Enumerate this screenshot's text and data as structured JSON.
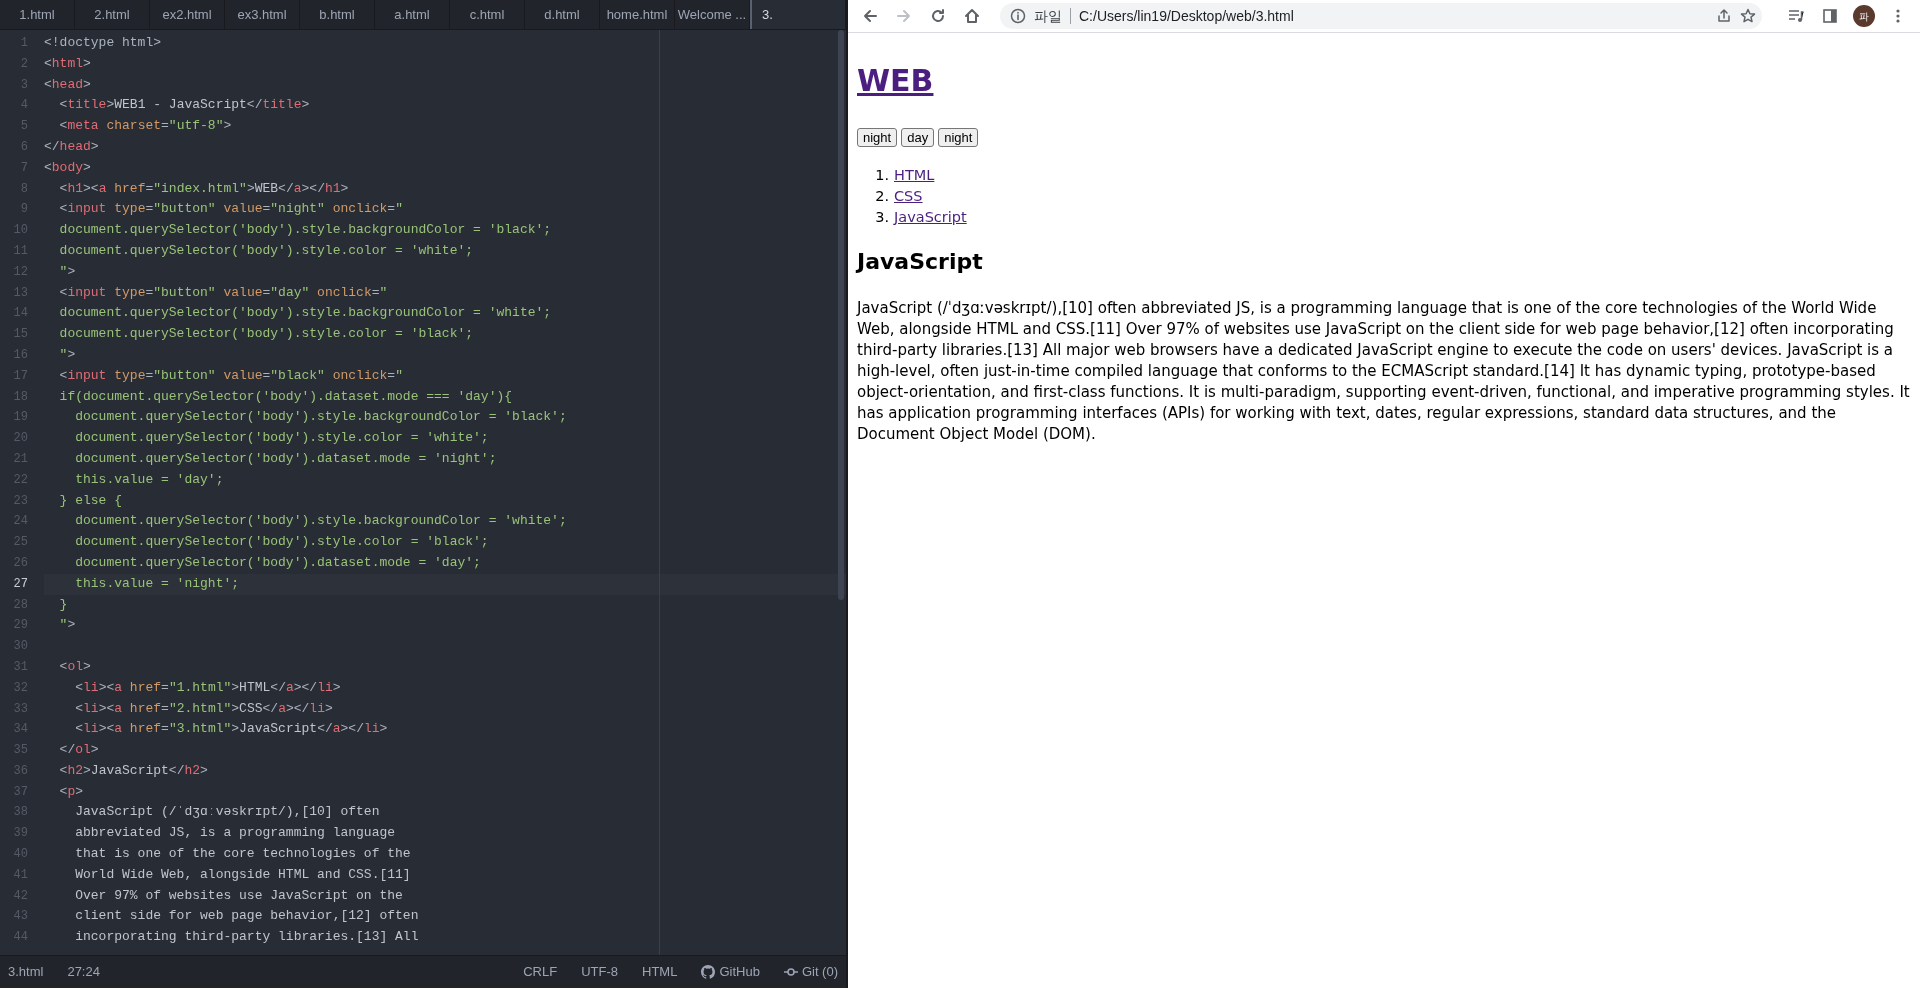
{
  "editor": {
    "tabs": [
      {
        "label": "1.html",
        "selected": false
      },
      {
        "label": "2.html",
        "selected": false
      },
      {
        "label": "ex2.html",
        "selected": false
      },
      {
        "label": "ex3.html",
        "selected": false
      },
      {
        "label": "b.html",
        "selected": false
      },
      {
        "label": "a.html",
        "selected": false
      },
      {
        "label": "c.html",
        "selected": false
      },
      {
        "label": "d.html",
        "selected": false
      },
      {
        "label": "home.html",
        "selected": false
      },
      {
        "label": "Welcome ...",
        "selected": false
      },
      {
        "label": "3.",
        "selected": true
      }
    ],
    "lines": [
      {
        "number": "1",
        "current": false,
        "tokens": [
          {
            "kind": "punct",
            "text": "<!doctype html>"
          }
        ]
      },
      {
        "number": "2",
        "current": false,
        "tokens": [
          {
            "kind": "punct",
            "text": "<"
          },
          {
            "kind": "tag",
            "text": "html"
          },
          {
            "kind": "punct",
            "text": ">"
          }
        ]
      },
      {
        "number": "3",
        "current": false,
        "tokens": [
          {
            "kind": "punct",
            "text": "<"
          },
          {
            "kind": "tag",
            "text": "head"
          },
          {
            "kind": "punct",
            "text": ">"
          }
        ]
      },
      {
        "number": "4",
        "current": false,
        "tokens": [
          {
            "kind": "punct",
            "text": "  <"
          },
          {
            "kind": "tag",
            "text": "title"
          },
          {
            "kind": "punct",
            "text": ">"
          },
          {
            "kind": "text",
            "text": "WEB1 - JavaScript"
          },
          {
            "kind": "punct",
            "text": "</"
          },
          {
            "kind": "tag",
            "text": "title"
          },
          {
            "kind": "punct",
            "text": ">"
          }
        ]
      },
      {
        "number": "5",
        "current": false,
        "tokens": [
          {
            "kind": "punct",
            "text": "  <"
          },
          {
            "kind": "tag",
            "text": "meta"
          },
          {
            "kind": "attr",
            "text": " charset"
          },
          {
            "kind": "punct",
            "text": "="
          },
          {
            "kind": "string",
            "text": "\"utf-8\""
          },
          {
            "kind": "punct",
            "text": ">"
          }
        ]
      },
      {
        "number": "6",
        "current": false,
        "tokens": [
          {
            "kind": "punct",
            "text": "</"
          },
          {
            "kind": "tag",
            "text": "head"
          },
          {
            "kind": "punct",
            "text": ">"
          }
        ]
      },
      {
        "number": "7",
        "current": false,
        "tokens": [
          {
            "kind": "punct",
            "text": "<"
          },
          {
            "kind": "tag",
            "text": "body"
          },
          {
            "kind": "punct",
            "text": ">"
          }
        ]
      },
      {
        "number": "8",
        "current": false,
        "tokens": [
          {
            "kind": "punct",
            "text": "  <"
          },
          {
            "kind": "tag",
            "text": "h1"
          },
          {
            "kind": "punct",
            "text": "><"
          },
          {
            "kind": "tag",
            "text": "a"
          },
          {
            "kind": "attr",
            "text": " href"
          },
          {
            "kind": "punct",
            "text": "="
          },
          {
            "kind": "string",
            "text": "\"index.html\""
          },
          {
            "kind": "punct",
            "text": ">"
          },
          {
            "kind": "text",
            "text": "WEB"
          },
          {
            "kind": "punct",
            "text": "</"
          },
          {
            "kind": "tag",
            "text": "a"
          },
          {
            "kind": "punct",
            "text": "></"
          },
          {
            "kind": "tag",
            "text": "h1"
          },
          {
            "kind": "punct",
            "text": ">"
          }
        ]
      },
      {
        "number": "9",
        "current": false,
        "tokens": [
          {
            "kind": "punct",
            "text": "  <"
          },
          {
            "kind": "tag",
            "text": "input"
          },
          {
            "kind": "attr",
            "text": " type"
          },
          {
            "kind": "punct",
            "text": "="
          },
          {
            "kind": "string",
            "text": "\"button\""
          },
          {
            "kind": "attr",
            "text": " value"
          },
          {
            "kind": "punct",
            "text": "="
          },
          {
            "kind": "string",
            "text": "\"night\""
          },
          {
            "kind": "attr",
            "text": " onclick"
          },
          {
            "kind": "punct",
            "text": "="
          },
          {
            "kind": "string",
            "text": "\""
          }
        ]
      },
      {
        "number": "10",
        "current": false,
        "tokens": [
          {
            "kind": "string",
            "text": "  document.querySelector('body').style.backgroundColor = 'black';"
          }
        ]
      },
      {
        "number": "11",
        "current": false,
        "tokens": [
          {
            "kind": "string",
            "text": "  document.querySelector('body').style.color = 'white';"
          }
        ]
      },
      {
        "number": "12",
        "current": false,
        "tokens": [
          {
            "kind": "string",
            "text": "  \""
          },
          {
            "kind": "punct",
            "text": ">"
          }
        ]
      },
      {
        "number": "13",
        "current": false,
        "tokens": [
          {
            "kind": "punct",
            "text": "  <"
          },
          {
            "kind": "tag",
            "text": "input"
          },
          {
            "kind": "attr",
            "text": " type"
          },
          {
            "kind": "punct",
            "text": "="
          },
          {
            "kind": "string",
            "text": "\"button\""
          },
          {
            "kind": "attr",
            "text": " value"
          },
          {
            "kind": "punct",
            "text": "="
          },
          {
            "kind": "string",
            "text": "\"day\""
          },
          {
            "kind": "attr",
            "text": " onclick"
          },
          {
            "kind": "punct",
            "text": "="
          },
          {
            "kind": "string",
            "text": "\""
          }
        ]
      },
      {
        "number": "14",
        "current": false,
        "tokens": [
          {
            "kind": "string",
            "text": "  document.querySelector('body').style.backgroundColor = 'white';"
          }
        ]
      },
      {
        "number": "15",
        "current": false,
        "tokens": [
          {
            "kind": "string",
            "text": "  document.querySelector('body').style.color = 'black';"
          }
        ]
      },
      {
        "number": "16",
        "current": false,
        "tokens": [
          {
            "kind": "string",
            "text": "  \""
          },
          {
            "kind": "punct",
            "text": ">"
          }
        ]
      },
      {
        "number": "17",
        "current": false,
        "tokens": [
          {
            "kind": "punct",
            "text": "  <"
          },
          {
            "kind": "tag",
            "text": "input"
          },
          {
            "kind": "attr",
            "text": " type"
          },
          {
            "kind": "punct",
            "text": "="
          },
          {
            "kind": "string",
            "text": "\"button\""
          },
          {
            "kind": "attr",
            "text": " value"
          },
          {
            "kind": "punct",
            "text": "="
          },
          {
            "kind": "string",
            "text": "\"black\""
          },
          {
            "kind": "attr",
            "text": " onclick"
          },
          {
            "kind": "punct",
            "text": "="
          },
          {
            "kind": "string",
            "text": "\""
          }
        ]
      },
      {
        "number": "18",
        "current": false,
        "tokens": [
          {
            "kind": "string",
            "text": "  if(document.querySelector('body').dataset.mode === 'day'){"
          }
        ]
      },
      {
        "number": "19",
        "current": false,
        "tokens": [
          {
            "kind": "string",
            "text": "    document.querySelector('body').style.backgroundColor = 'black';"
          }
        ]
      },
      {
        "number": "20",
        "current": false,
        "tokens": [
          {
            "kind": "string",
            "text": "    document.querySelector('body').style.color = 'white';"
          }
        ]
      },
      {
        "number": "21",
        "current": false,
        "tokens": [
          {
            "kind": "string",
            "text": "    document.querySelector('body').dataset.mode = 'night';"
          }
        ]
      },
      {
        "number": "22",
        "current": false,
        "tokens": [
          {
            "kind": "string",
            "text": "    this.value = 'day';"
          }
        ]
      },
      {
        "number": "23",
        "current": false,
        "tokens": [
          {
            "kind": "string",
            "text": "  } else {"
          }
        ]
      },
      {
        "number": "24",
        "current": false,
        "tokens": [
          {
            "kind": "string",
            "text": "    document.querySelector('body').style.backgroundColor = 'white';"
          }
        ]
      },
      {
        "number": "25",
        "current": false,
        "tokens": [
          {
            "kind": "string",
            "text": "    document.querySelector('body').style.color = 'black';"
          }
        ]
      },
      {
        "number": "26",
        "current": false,
        "tokens": [
          {
            "kind": "string",
            "text": "    document.querySelector('body').dataset.mode = 'day';"
          }
        ]
      },
      {
        "number": "27",
        "current": true,
        "tokens": [
          {
            "kind": "string",
            "text": "    this.value = 'night';"
          }
        ]
      },
      {
        "number": "28",
        "current": false,
        "tokens": [
          {
            "kind": "string",
            "text": "  }"
          }
        ]
      },
      {
        "number": "29",
        "current": false,
        "tokens": [
          {
            "kind": "string",
            "text": "  \""
          },
          {
            "kind": "punct",
            "text": ">"
          }
        ]
      },
      {
        "number": "30",
        "current": false
      },
      {
        "number": "31",
        "current": false,
        "tokens": [
          {
            "kind": "punct",
            "text": "  <"
          },
          {
            "kind": "tag",
            "text": "ol"
          },
          {
            "kind": "punct",
            "text": ">"
          }
        ]
      },
      {
        "number": "32",
        "current": false,
        "tokens": [
          {
            "kind": "punct",
            "text": "    <"
          },
          {
            "kind": "tag",
            "text": "li"
          },
          {
            "kind": "punct",
            "text": "><"
          },
          {
            "kind": "tag",
            "text": "a"
          },
          {
            "kind": "attr",
            "text": " href"
          },
          {
            "kind": "punct",
            "text": "="
          },
          {
            "kind": "string",
            "text": "\"1.html\""
          },
          {
            "kind": "punct",
            "text": ">"
          },
          {
            "kind": "text",
            "text": "HTML"
          },
          {
            "kind": "punct",
            "text": "</"
          },
          {
            "kind": "tag",
            "text": "a"
          },
          {
            "kind": "punct",
            "text": "></"
          },
          {
            "kind": "tag",
            "text": "li"
          },
          {
            "kind": "punct",
            "text": ">"
          }
        ]
      },
      {
        "number": "33",
        "current": false,
        "tokens": [
          {
            "kind": "punct",
            "text": "    <"
          },
          {
            "kind": "tag",
            "text": "li"
          },
          {
            "kind": "punct",
            "text": "><"
          },
          {
            "kind": "tag",
            "text": "a"
          },
          {
            "kind": "attr",
            "text": " href"
          },
          {
            "kind": "punct",
            "text": "="
          },
          {
            "kind": "string",
            "text": "\"2.html\""
          },
          {
            "kind": "punct",
            "text": ">"
          },
          {
            "kind": "text",
            "text": "CSS"
          },
          {
            "kind": "punct",
            "text": "</"
          },
          {
            "kind": "tag",
            "text": "a"
          },
          {
            "kind": "punct",
            "text": "></"
          },
          {
            "kind": "tag",
            "text": "li"
          },
          {
            "kind": "punct",
            "text": ">"
          }
        ]
      },
      {
        "number": "34",
        "current": false,
        "tokens": [
          {
            "kind": "punct",
            "text": "    <"
          },
          {
            "kind": "tag",
            "text": "li"
          },
          {
            "kind": "punct",
            "text": "><"
          },
          {
            "kind": "tag",
            "text": "a"
          },
          {
            "kind": "attr",
            "text": " href"
          },
          {
            "kind": "punct",
            "text": "="
          },
          {
            "kind": "string",
            "text": "\"3.html\""
          },
          {
            "kind": "punct",
            "text": ">"
          },
          {
            "kind": "text",
            "text": "JavaScript"
          },
          {
            "kind": "punct",
            "text": "</"
          },
          {
            "kind": "tag",
            "text": "a"
          },
          {
            "kind": "punct",
            "text": "></"
          },
          {
            "kind": "tag",
            "text": "li"
          },
          {
            "kind": "punct",
            "text": ">"
          }
        ]
      },
      {
        "number": "35",
        "current": false,
        "tokens": [
          {
            "kind": "punct",
            "text": "  </"
          },
          {
            "kind": "tag",
            "text": "ol"
          },
          {
            "kind": "punct",
            "text": ">"
          }
        ]
      },
      {
        "number": "36",
        "current": false,
        "tokens": [
          {
            "kind": "punct",
            "text": "  <"
          },
          {
            "kind": "tag",
            "text": "h2"
          },
          {
            "kind": "punct",
            "text": ">"
          },
          {
            "kind": "text",
            "text": "JavaScript"
          },
          {
            "kind": "punct",
            "text": "</"
          },
          {
            "kind": "tag",
            "text": "h2"
          },
          {
            "kind": "punct",
            "text": ">"
          }
        ]
      },
      {
        "number": "37",
        "current": false,
        "tokens": [
          {
            "kind": "punct",
            "text": "  <"
          },
          {
            "kind": "tag",
            "text": "p"
          },
          {
            "kind": "punct",
            "text": ">"
          }
        ]
      },
      {
        "number": "38",
        "current": false,
        "tokens": [
          {
            "kind": "text",
            "text": "    JavaScript (/ˈdʒɑːvəskrɪpt/),[10] often"
          }
        ]
      },
      {
        "number": "39",
        "current": false,
        "tokens": [
          {
            "kind": "text",
            "text": "    abbreviated JS, is a programming language"
          }
        ]
      },
      {
        "number": "40",
        "current": false,
        "tokens": [
          {
            "kind": "text",
            "text": "    that is one of the core technologies of the"
          }
        ]
      },
      {
        "number": "41",
        "current": false,
        "tokens": [
          {
            "kind": "text",
            "text": "    World Wide Web, alongside HTML and CSS.[11]"
          }
        ]
      },
      {
        "number": "42",
        "current": false,
        "tokens": [
          {
            "kind": "text",
            "text": "    Over 97% of websites use JavaScript on the"
          }
        ]
      },
      {
        "number": "43",
        "current": false,
        "tokens": [
          {
            "kind": "text",
            "text": "    client side for web page behavior,[12] often"
          }
        ]
      },
      {
        "number": "44",
        "current": false,
        "tokens": [
          {
            "kind": "text",
            "text": "    incorporating third-party libraries.[13] All"
          }
        ]
      }
    ],
    "status_bar": {
      "file": "3.html",
      "cursor": "27:24",
      "line_ending": "CRLF",
      "encoding": "UTF-8",
      "grammar": "HTML",
      "github": "GitHub",
      "git": "Git (0)"
    }
  },
  "browser": {
    "toolbar": {
      "forward_disabled": true,
      "scheme_label": "파일",
      "url": "C:/Users/lin19/Desktop/web/3.html",
      "avatar": "파"
    },
    "page": {
      "heading": "WEB",
      "buttons": [
        "night",
        "day",
        "night"
      ],
      "links": [
        {
          "number": "1.",
          "label": "HTML"
        },
        {
          "number": "2.",
          "label": "CSS"
        },
        {
          "number": "3.",
          "label": "JavaScript"
        }
      ],
      "subheading": "JavaScript",
      "paragraph": "JavaScript (/ˈdʒɑːvəskrɪpt/),[10] often abbreviated JS, is a programming language that is one of the core technologies of the World Wide Web, alongside HTML and CSS.[11] Over 97% of websites use JavaScript on the client side for web page behavior,[12] often incorporating third-party libraries.[13] All major web browsers have a dedicated JavaScript engine to execute the code on users' devices. JavaScript is a high-level, often just-in-time compiled language that conforms to the ECMAScript standard.[14] It has dynamic typing, prototype-based object-orientation, and first-class functions. It is multi-paradigm, supporting event-driven, functional, and imperative programming styles. It has application programming interfaces (APIs) for working with text, dates, regular expressions, standard data structures, and the Document Object Model (DOM)."
    }
  }
}
